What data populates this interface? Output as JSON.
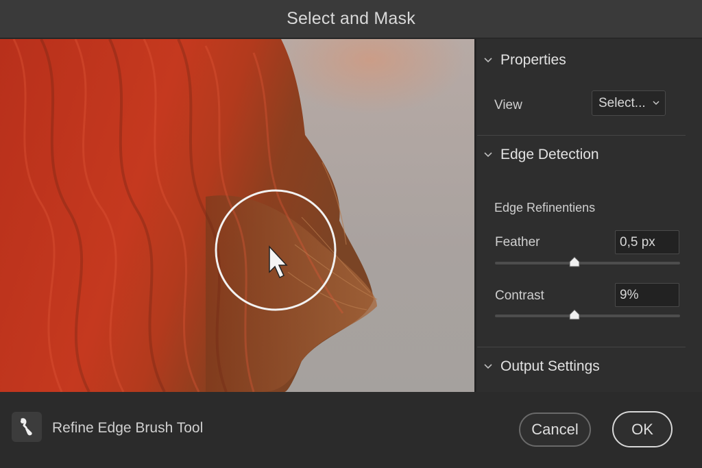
{
  "window": {
    "title": "Select and Mask"
  },
  "panel": {
    "properties": {
      "heading": "Properties",
      "view_label": "View",
      "view_value": "Select..."
    },
    "edge_detection": {
      "heading": "Edge Detection",
      "subheading": "Edge Refinentiens",
      "feather": {
        "label": "Feather",
        "value": "0,5 px",
        "slider_level": 0.43
      },
      "contrast": {
        "label": "Contrast",
        "value": "9%",
        "slider_level": 0.43
      }
    },
    "output_settings": {
      "heading": "Output Settings"
    }
  },
  "footer": {
    "tool_label": "Refine Edge Brush Tool",
    "tool_icon": "refine-edge-brush-icon",
    "cancel_label": "Cancel",
    "ok_label": "OK"
  },
  "colors": {
    "hair": "#c0361f",
    "hair_tips": "#8a4a25",
    "background": "#aaa3a0",
    "brush_ring": "#f2f2f2"
  }
}
